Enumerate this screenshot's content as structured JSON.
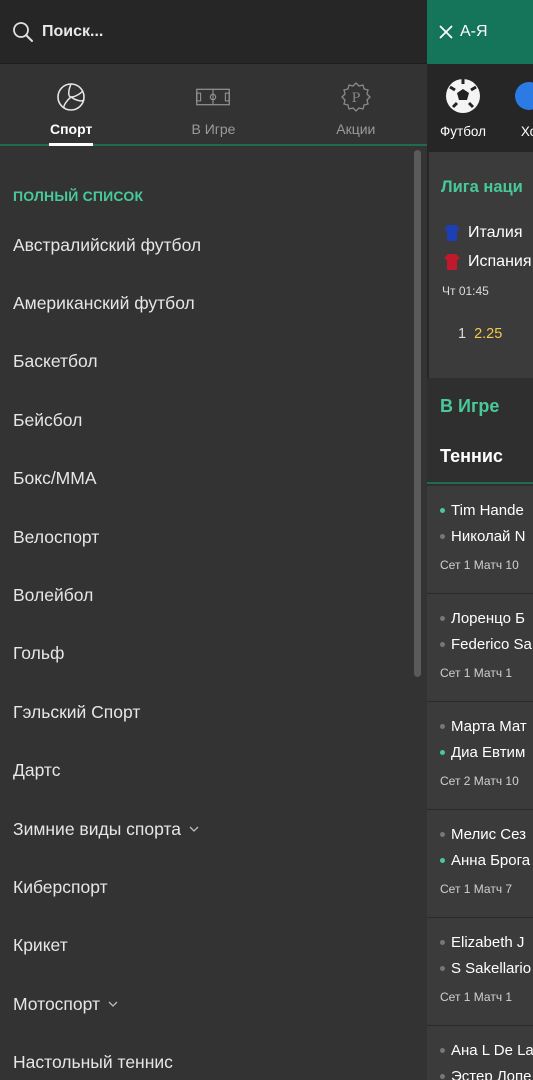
{
  "search": {
    "placeholder": "Поиск..."
  },
  "tabs": [
    {
      "label": "Спорт",
      "icon": "volleyball-icon",
      "active": true
    },
    {
      "label": "В Игре",
      "icon": "pitch-icon",
      "active": false
    },
    {
      "label": "Акции",
      "icon": "promo-badge-icon",
      "active": false
    }
  ],
  "list_title": "ПОЛНЫЙ СПИСОК",
  "sports": [
    {
      "label": "Австралийский футбол"
    },
    {
      "label": "Американский футбол"
    },
    {
      "label": "Баскетбол"
    },
    {
      "label": "Бейсбол"
    },
    {
      "label": "Бокс/MMA"
    },
    {
      "label": "Велоспорт"
    },
    {
      "label": "Волейбол"
    },
    {
      "label": "Гольф"
    },
    {
      "label": "Гэльский Спорт"
    },
    {
      "label": "Дартс"
    },
    {
      "label": "Зимние виды спорта",
      "expandable": true
    },
    {
      "label": "Киберспорт"
    },
    {
      "label": "Крикет"
    },
    {
      "label": "Мотоспорт",
      "expandable": true
    },
    {
      "label": "Настольный теннис"
    }
  ],
  "main": {
    "az_label": "А-Я",
    "strip": [
      {
        "label": "Футбол",
        "icon": "soccer-ball-icon"
      },
      {
        "label": "Хо",
        "icon": "hockey-icon"
      }
    ],
    "league": {
      "title": "Лига наци",
      "home": "Италия",
      "away": "Испания",
      "time": "Чт 01:45",
      "odd_label": "1",
      "odd_value": "2.25"
    },
    "inplay_title": "В Игре",
    "sport_heading": "Теннис",
    "matches": [
      {
        "p1": "Tim Hande",
        "p2": "Николай N",
        "serve": 1,
        "info": "Сет 1 Матч 10"
      },
      {
        "p1": "Лоренцо Б",
        "p2": "Federico Sa",
        "serve": 0,
        "info": "Сет 1 Матч 1"
      },
      {
        "p1": "Марта Мат",
        "p2": "Диа Евтим",
        "serve": 2,
        "info": "Сет 2 Матч 10"
      },
      {
        "p1": "Мелис Сез",
        "p2": "Анна Брога",
        "serve": 2,
        "info": "Сет 1 Матч 7"
      },
      {
        "p1": "Elizabeth J",
        "p2": "S Sakellario",
        "serve": 0,
        "info": "Сет 1 Матч 1"
      },
      {
        "p1": "Ана L De La",
        "p2": "Эстер Лопе",
        "serve": 0,
        "info": ""
      }
    ]
  },
  "colors": {
    "accent": "#49c99a",
    "az_bg": "#14755a",
    "odds": "#f2c94c"
  }
}
